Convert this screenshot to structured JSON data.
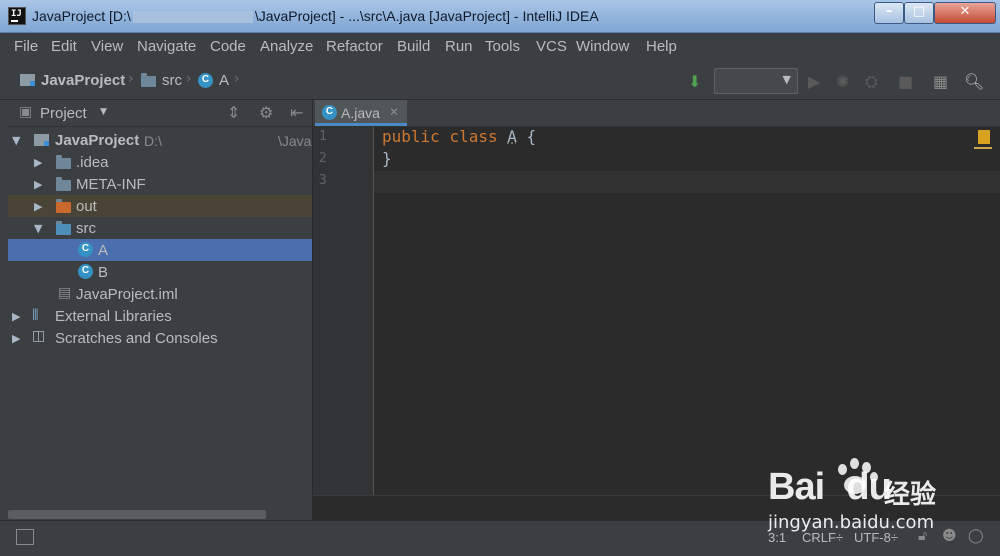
{
  "window": {
    "title_prefix": "JavaProject [D:\\",
    "title_suffix": "\\JavaProject] - ...\\src\\A.java [JavaProject] - IntelliJ IDEA",
    "app_icon_text": "IJ",
    "min_glyph": "–",
    "max_glyph": "□",
    "close_glyph": "✕"
  },
  "menu": [
    "File",
    "Edit",
    "View",
    "Navigate",
    "Code",
    "Analyze",
    "Refactor",
    "Build",
    "Run",
    "Tools",
    "VCS",
    "Window",
    "Help"
  ],
  "breadcrumb": {
    "project": "JavaProject",
    "folder": "src",
    "file": "A"
  },
  "project_panel": {
    "title": "Project",
    "dropdown_glyph": "▼",
    "root": {
      "name": "JavaProject",
      "path_start": "D:\\",
      "path_end": "\\Java"
    },
    "items": [
      {
        "name": ".idea"
      },
      {
        "name": "META-INF"
      },
      {
        "name": "out"
      },
      {
        "name": "src"
      },
      {
        "name": "A"
      },
      {
        "name": "B"
      },
      {
        "name": "JavaProject.iml"
      },
      {
        "name": "External Libraries"
      },
      {
        "name": "Scratches and Consoles"
      }
    ]
  },
  "editor": {
    "tab_label": "A.java",
    "line_numbers": [
      "1",
      "2",
      "3"
    ],
    "code": {
      "kw_public": "public",
      "kw_class": "class",
      "class_name": "A",
      "open_brace": "{",
      "close_brace": "}"
    }
  },
  "status": {
    "position": "3:1",
    "line_sep": "CRLF÷",
    "encoding": "UTF-8÷"
  },
  "watermark": {
    "brand": "Bai",
    "brand_suffix": "du",
    "brand_cn": "经验",
    "url": "jingyan.baidu.com"
  }
}
